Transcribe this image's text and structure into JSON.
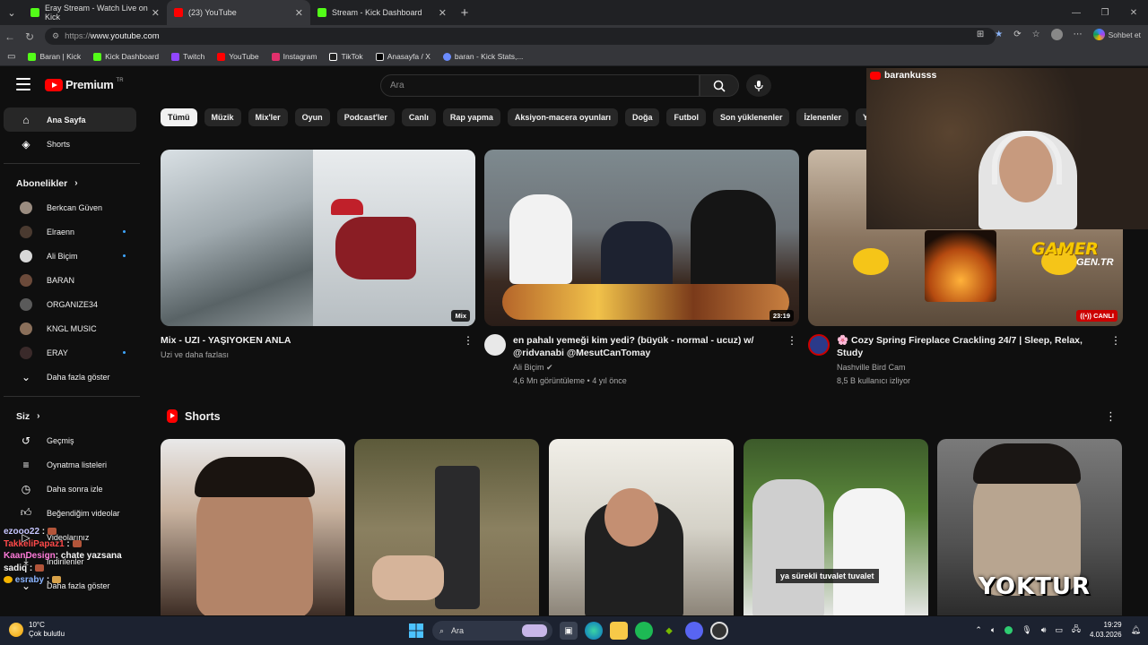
{
  "browser": {
    "tabs": [
      {
        "label": "Eray Stream - Watch Live on Kick",
        "color": "#53fc18"
      },
      {
        "label": "(23) YouTube",
        "color": "#ff0000"
      },
      {
        "label": "Stream - Kick Dashboard",
        "color": "#53fc18"
      }
    ],
    "url_proto": "https://",
    "url_host": "www.youtube.com",
    "copilot_label": "Sohbet et",
    "bookmarks": [
      {
        "label": "Baran | Kick",
        "color": "#53fc18"
      },
      {
        "label": "Kick Dashboard",
        "color": "#53fc18"
      },
      {
        "label": "Twitch",
        "color": "#9146ff"
      },
      {
        "label": "YouTube",
        "color": "#ff0000"
      },
      {
        "label": "Instagram",
        "color": "#e1306c"
      },
      {
        "label": "TikTok",
        "color": "#ffffff"
      },
      {
        "label": "Anasayfa / X",
        "color": "#ffffff"
      },
      {
        "label": "baran - Kick Stats,...",
        "color": "#6b8cff"
      }
    ]
  },
  "youtube": {
    "logo_text": "Premium",
    "logo_region": "TR",
    "search_placeholder": "Ara",
    "sidebar": {
      "main": [
        {
          "label": "Ana Sayfa",
          "icon": "home-icon"
        },
        {
          "label": "Shorts",
          "icon": "shorts-icon"
        }
      ],
      "subs_heading": "Abonelikler",
      "subs": [
        {
          "label": "Berkcan Güven",
          "color": "#9a8c80",
          "dot": false
        },
        {
          "label": "Elraenn",
          "color": "#4a3a30",
          "dot": true
        },
        {
          "label": "Ali Biçim",
          "color": "#d8d8d8",
          "dot": true
        },
        {
          "label": "BARAN",
          "color": "#6b4a3a",
          "dot": false
        },
        {
          "label": "ORGANIZE34",
          "color": "#5a5a5a",
          "dot": false
        },
        {
          "label": "KNGL MUSIC",
          "color": "#8a6f5a",
          "dot": false
        },
        {
          "label": "ERAY",
          "color": "#3a2a2a",
          "dot": true
        }
      ],
      "show_more": "Daha fazla göster",
      "you_heading": "Siz",
      "you": [
        {
          "label": "Geçmiş",
          "icon": "history-icon"
        },
        {
          "label": "Oynatma listeleri",
          "icon": "playlist-icon"
        },
        {
          "label": "Daha sonra izle",
          "icon": "clock-icon"
        },
        {
          "label": "Beğendiğim videolar",
          "icon": "like-icon"
        },
        {
          "label": "Videolarınız",
          "icon": "video-icon"
        },
        {
          "label": "İndirilenler",
          "icon": "download-icon"
        },
        {
          "label": "Daha fazla göster",
          "icon": "chevron-down-icon"
        }
      ]
    },
    "chips": [
      "Tümü",
      "Müzik",
      "Mix'ler",
      "Oyun",
      "Podcast'ler",
      "Canlı",
      "Rap yapma",
      "Aksiyon-macera oyunları",
      "Doğa",
      "Futbol",
      "Son yüklenenler",
      "İzlenenler",
      "Yeni"
    ],
    "videos": [
      {
        "title": "Mix - UZI - YAŞIYOKEN ANLA",
        "sub1": "Uzi ve daha fazlası",
        "sub2": "",
        "badge": "Mix",
        "avatar": false,
        "avatar_color": "#000000"
      },
      {
        "title": "en pahalı yemeği kim yedi? (büyük - normal - ucuz) w/ @ridvanabi @MesutCanTomay",
        "sub1": "Ali Biçim ✔",
        "sub2": "4,6 Mn görüntüleme • 4 yıl önce",
        "badge": "23:19",
        "avatar": true,
        "avatar_color": "#e8e8e8"
      },
      {
        "title": "🌸 Cozy Spring Fireplace Crackling 24/7 | Sleep, Relax, Study",
        "sub1": "Nashville Bird Cam",
        "sub2": "8,5 B kullanıcı izliyor",
        "badge": "((•)) CANLI",
        "avatar": true,
        "avatar_color": "#2b3a8a"
      }
    ],
    "shorts_heading": "Shorts",
    "short_captions": [
      "",
      "",
      "",
      "ya sürekli tuvalet tuvalet",
      "YOKTUR"
    ]
  },
  "overlay": {
    "cam_channel": "barankusss",
    "brand1": "GAMER",
    "brand2": "GEN.TR",
    "chat": [
      {
        "user": "ezooo22",
        "msg": ":"
      },
      {
        "user": "TakkeliPapaz1",
        "msg": ":"
      },
      {
        "user": "KaanDesign",
        "msg": ": chate yazsana"
      },
      {
        "user": "sadiq",
        "msg": ":"
      },
      {
        "user": "esraby",
        "msg": ":"
      }
    ]
  },
  "taskbar": {
    "temp": "10°C",
    "weather": "Çok bulutlu",
    "search": "Ara",
    "time": "19:29",
    "date": "4.03.2026"
  }
}
